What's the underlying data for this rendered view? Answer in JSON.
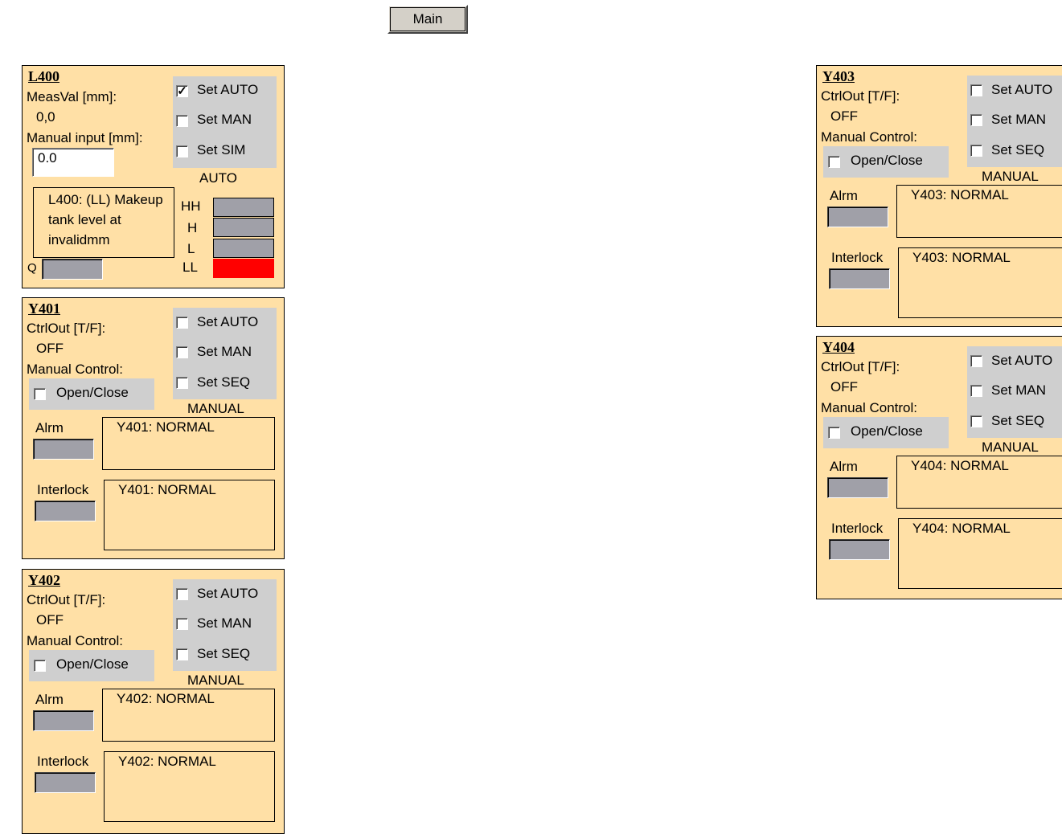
{
  "main_button": "Main",
  "level_panel": {
    "title": "L400",
    "meas_label": "MeasVal [mm]:",
    "meas_value": "0,0",
    "manual_label": "Manual input [mm]:",
    "manual_value": "0.0",
    "modes": [
      {
        "label": "Set AUTO",
        "checked": true
      },
      {
        "label": "Set MAN",
        "checked": false
      },
      {
        "label": "Set SIM",
        "checked": false
      }
    ],
    "mode_status": "AUTO",
    "message": "L400: (LL) Makeup tank level at invalidmm",
    "q_label": "Q",
    "levels": [
      {
        "label": "HH",
        "color": "#a0a0a8"
      },
      {
        "label": "H",
        "color": "#a0a0a8"
      },
      {
        "label": "L",
        "color": "#a0a0a8"
      },
      {
        "label": "LL",
        "color": "#ff0000"
      }
    ]
  },
  "valves": [
    {
      "id": "Y401",
      "ctrl_label": "CtrlOut [T/F]:",
      "ctrl_value": "OFF",
      "manual_label": "Manual Control:",
      "open_close": "Open/Close",
      "modes": [
        "Set AUTO",
        "Set MAN",
        "Set SEQ"
      ],
      "mode_status": "MANUAL",
      "alarm_label": "Alrm",
      "alarm_msg": "Y401: NORMAL",
      "interlock_label": "Interlock",
      "interlock_msg": "Y401: NORMAL"
    },
    {
      "id": "Y402",
      "ctrl_label": "CtrlOut [T/F]:",
      "ctrl_value": "OFF",
      "manual_label": "Manual Control:",
      "open_close": "Open/Close",
      "modes": [
        "Set AUTO",
        "Set MAN",
        "Set SEQ"
      ],
      "mode_status": "MANUAL",
      "alarm_label": "Alrm",
      "alarm_msg": "Y402: NORMAL",
      "interlock_label": "Interlock",
      "interlock_msg": "Y402: NORMAL"
    },
    {
      "id": "Y403",
      "ctrl_label": "CtrlOut [T/F]:",
      "ctrl_value": "OFF",
      "manual_label": "Manual Control:",
      "open_close": "Open/Close",
      "modes": [
        "Set AUTO",
        "Set MAN",
        "Set SEQ"
      ],
      "mode_status": "MANUAL",
      "alarm_label": "Alrm",
      "alarm_msg": "Y403: NORMAL",
      "interlock_label": "Interlock",
      "interlock_msg": "Y403: NORMAL"
    },
    {
      "id": "Y404",
      "ctrl_label": "CtrlOut [T/F]:",
      "ctrl_value": "OFF",
      "manual_label": "Manual Control:",
      "open_close": "Open/Close",
      "modes": [
        "Set AUTO",
        "Set MAN",
        "Set SEQ"
      ],
      "mode_status": "MANUAL",
      "alarm_label": "Alrm",
      "alarm_msg": "Y404: NORMAL",
      "interlock_label": "Interlock",
      "interlock_msg": "Y404: NORMAL"
    }
  ]
}
